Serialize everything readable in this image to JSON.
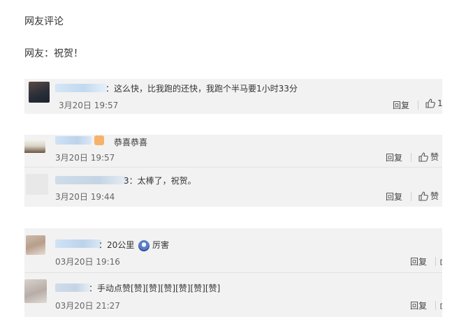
{
  "page": {
    "heading": "网友评论",
    "comment": "网友：祝贺！"
  },
  "comments": [
    {
      "text": "：这么快，比我跑的还快，我跑个半马要1小时33分",
      "time": "3月20日 19:57",
      "reply": "回复",
      "like": "1"
    },
    {
      "text": "恭喜恭喜",
      "time": "3月20日 19:57",
      "reply": "回复",
      "like": "赞"
    },
    {
      "text": "3：太棒了，祝贺。",
      "time": "3月20日 19:44",
      "reply": "回复",
      "like": "赞"
    },
    {
      "text_before": "：20公里",
      "text_after": "厉害",
      "time": "03月20日 19:16",
      "reply": "回复"
    },
    {
      "text": "：手动点赞[赞][赞][赞][赞][赞][赞]",
      "time": "03月20日 21:27",
      "reply": "回复"
    }
  ],
  "icons": {
    "like": "thumbs-up-icon",
    "emoji": "cool-face-emoji-icon"
  },
  "colors": {
    "card_bg": "#f2f2f2",
    "username_blur": "#c8dcf0"
  }
}
